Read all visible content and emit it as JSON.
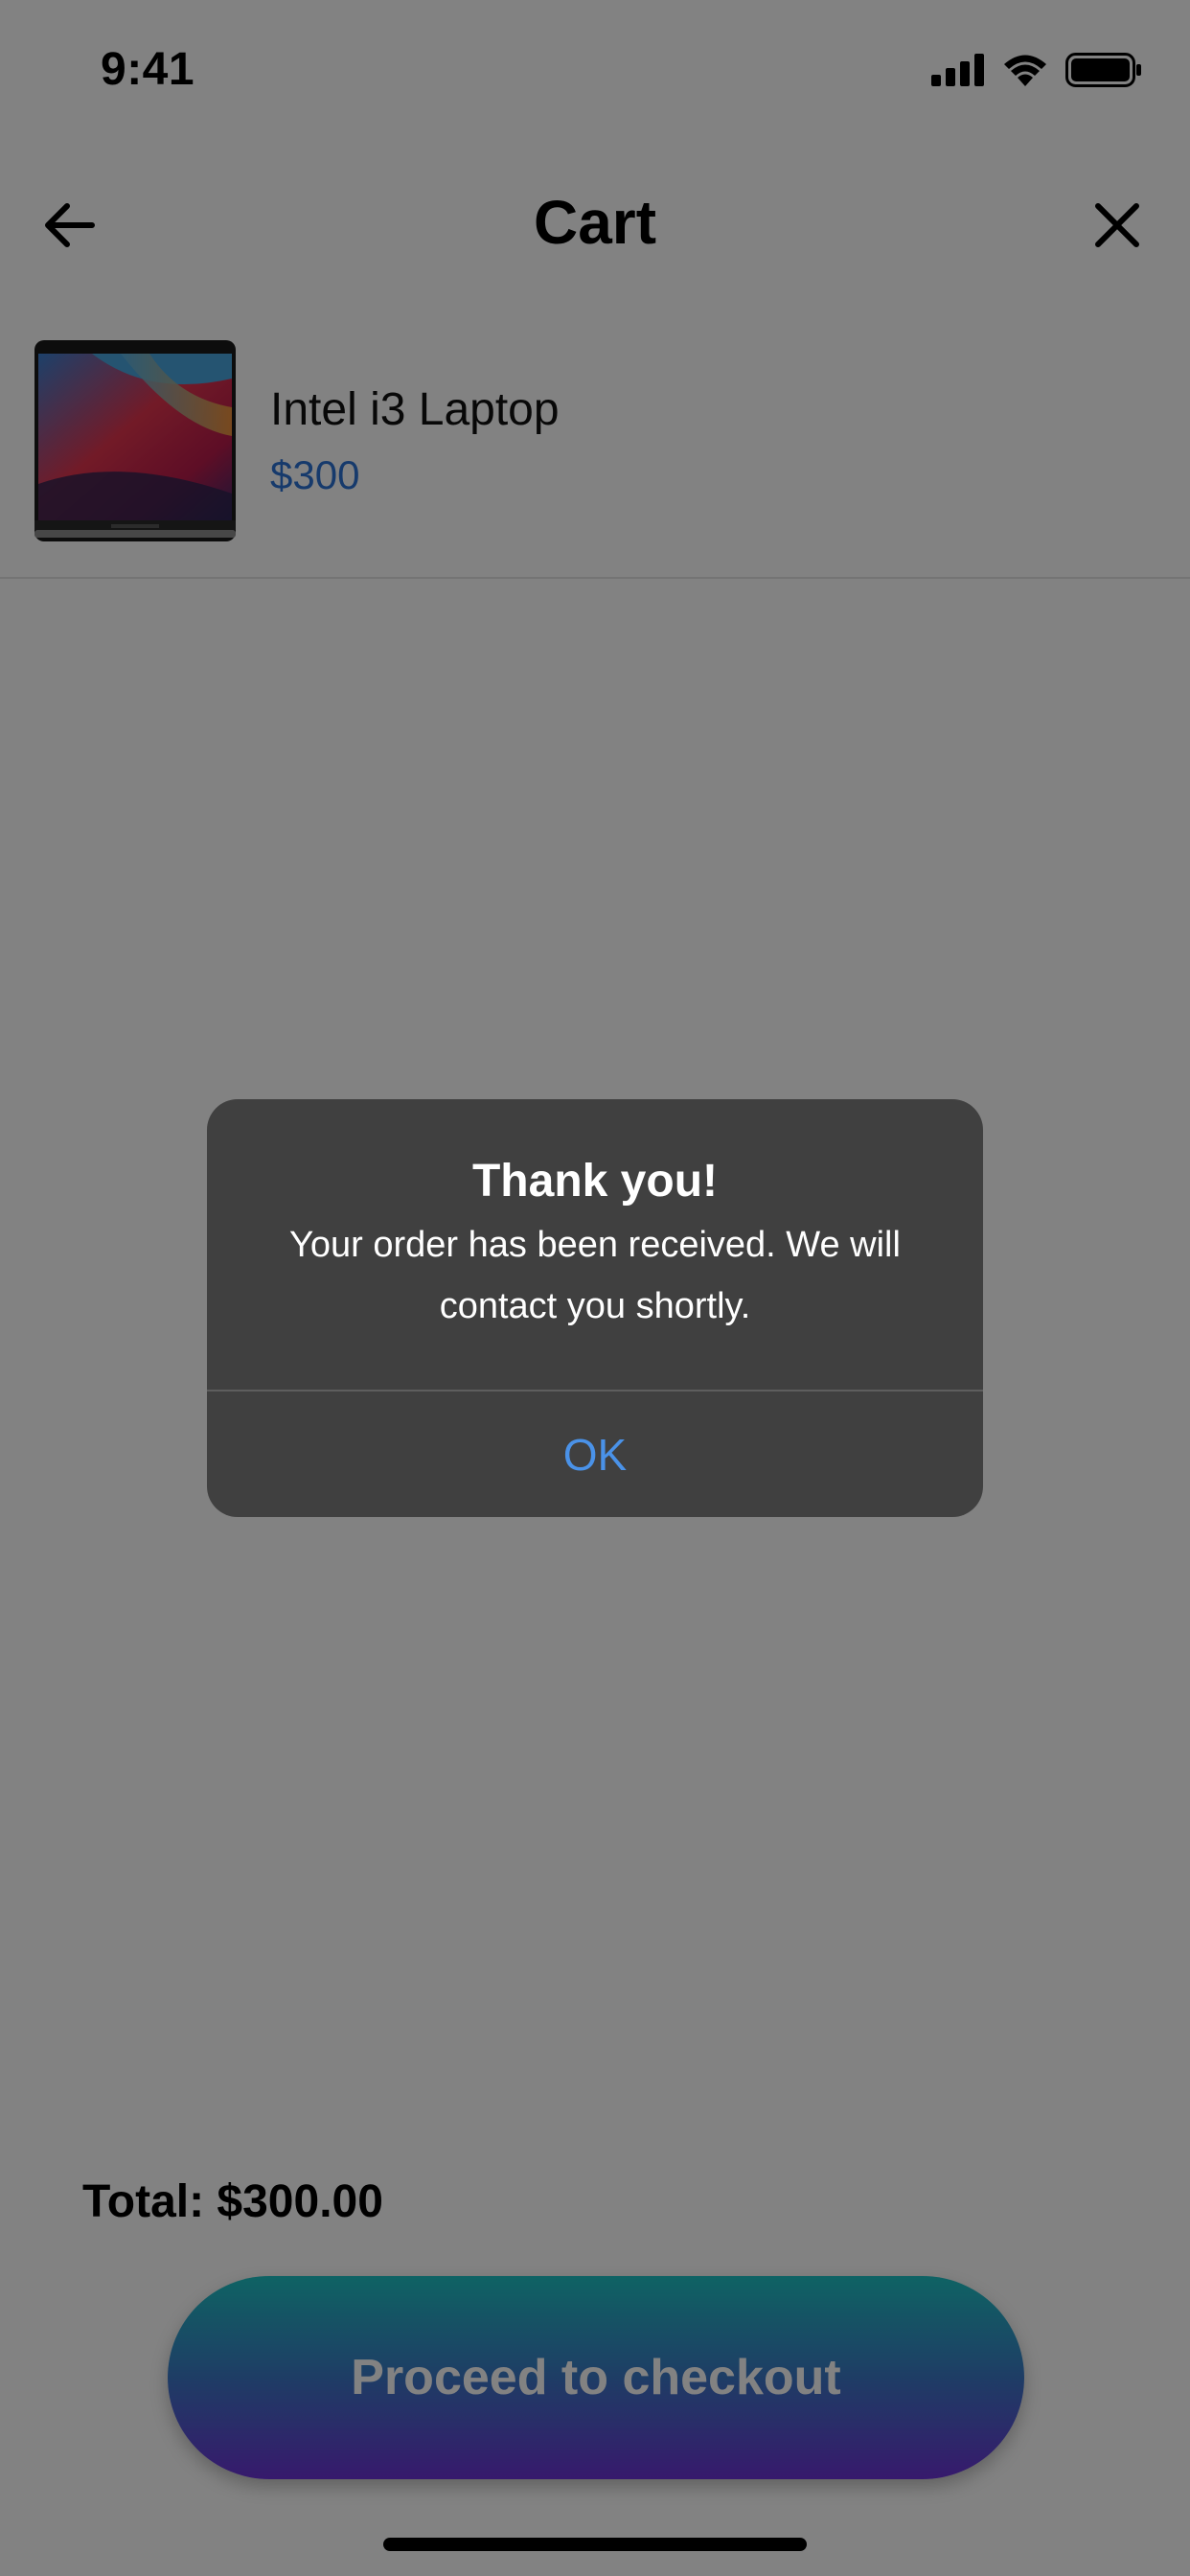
{
  "status_bar": {
    "time": "9:41"
  },
  "nav": {
    "title": "Cart"
  },
  "cart_items": [
    {
      "name": "Intel i3 Laptop",
      "price": "$300"
    }
  ],
  "footer": {
    "total": "Total: $300.00",
    "checkout_label": "Proceed to checkout"
  },
  "alert": {
    "title": "Thank you!",
    "message": "Your order has been received. We will contact you shortly.",
    "ok_label": "OK"
  },
  "colors": {
    "price": "#2b72d4",
    "alert_bg": "#404040",
    "alert_button": "#4a92e8",
    "gradient_top": "#1ec2c4",
    "gradient_bottom": "#6c33d6"
  }
}
